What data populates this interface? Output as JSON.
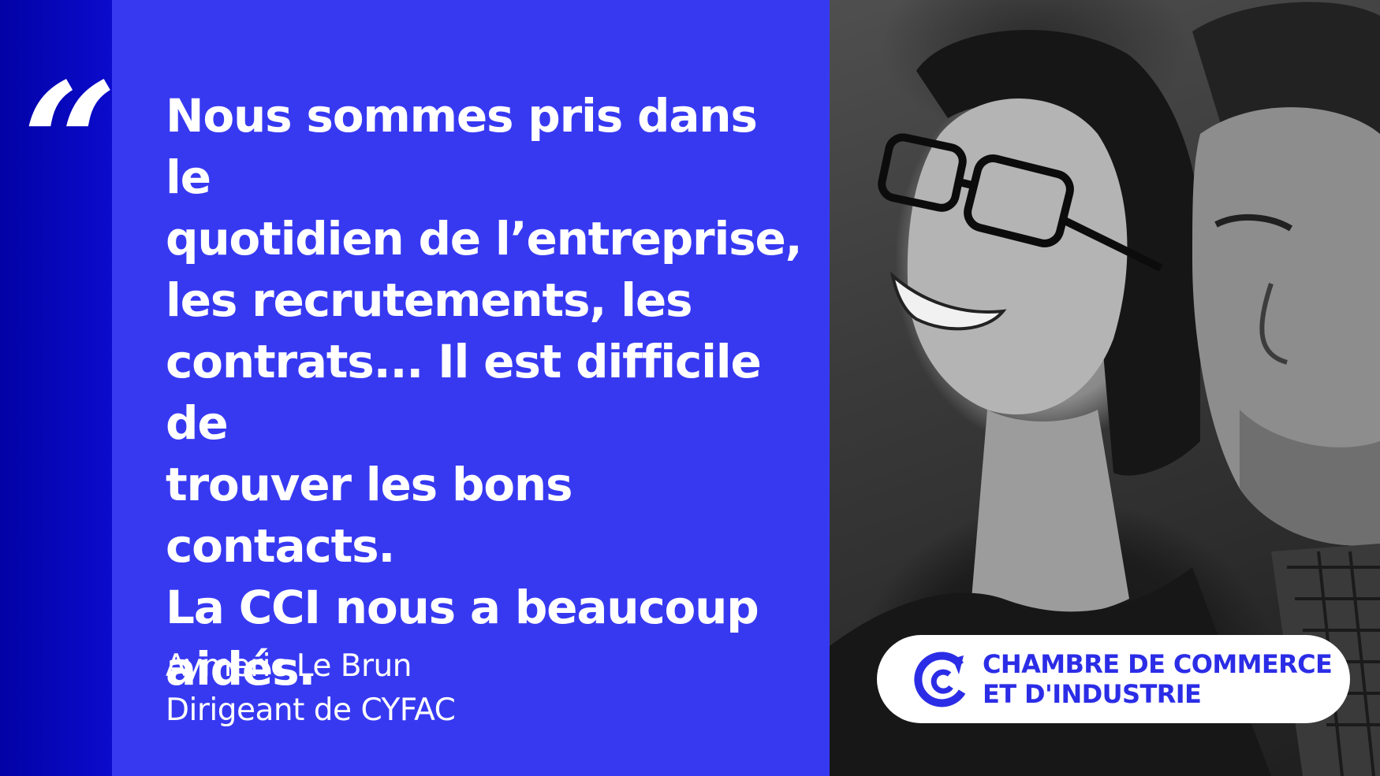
{
  "quote": {
    "mark": "“",
    "lines": [
      "Nous sommes pris dans le",
      "quotidien de l’entreprise,",
      "les recrutements, les",
      "contrats... Il est difficile de",
      "trouver les bons contacts.",
      "La CCI nous a beaucoup",
      "aidés."
    ]
  },
  "author": {
    "name": "Aymeric Le Brun",
    "role": "Dirigeant de CYFAC"
  },
  "badge": {
    "logo_icon": "cci-logo-icon",
    "line1": "CHAMBRE DE COMMERCE",
    "line2": "ET D'INDUSTRIE"
  },
  "photo": {
    "style": "black-and-white portrait"
  },
  "colors": {
    "left_bar": "#0b0bcc",
    "panel": "#3739f1",
    "text": "#ffffff",
    "brand": "#2b2de6"
  }
}
